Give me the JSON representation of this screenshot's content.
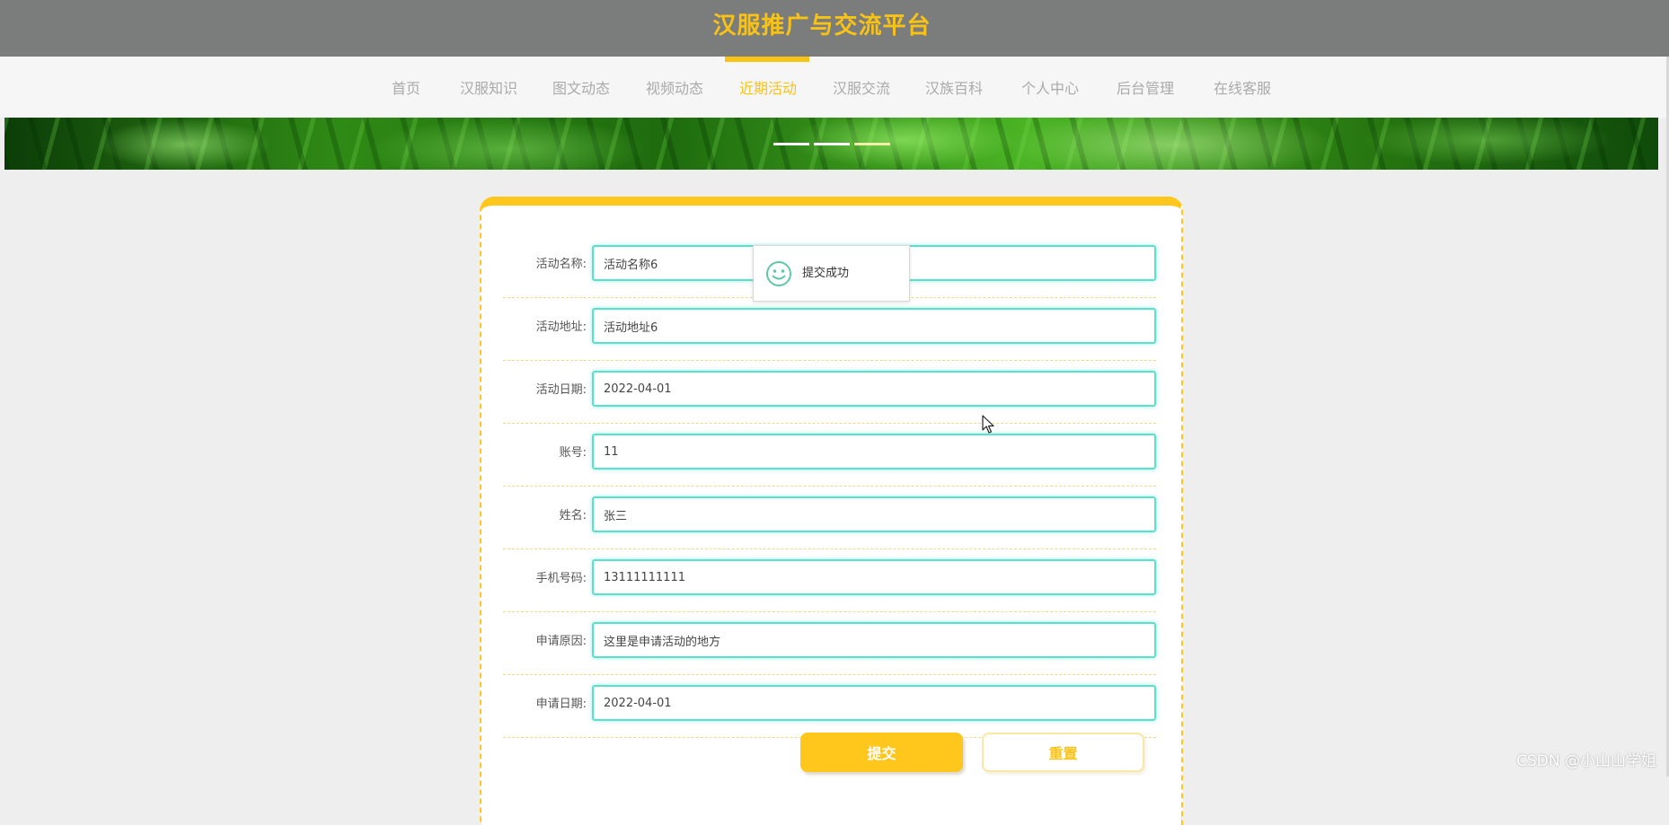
{
  "site": {
    "title": "汉服推广与交流平台"
  },
  "nav": {
    "items": [
      "首页",
      "汉服知识",
      "图文动态",
      "视频动态",
      "近期活动",
      "汉服交流",
      "汉族百科",
      "个人中心",
      "后台管理",
      "在线客服"
    ],
    "active_index": 4
  },
  "banner": {
    "slide_count": 3,
    "active_slide": 3
  },
  "form": {
    "fields": [
      {
        "label": "活动名称:",
        "value": "活动名称6"
      },
      {
        "label": "活动地址:",
        "value": "活动地址6"
      },
      {
        "label": "活动日期:",
        "value": "2022-04-01"
      },
      {
        "label": "账号:",
        "value": "11"
      },
      {
        "label": "姓名:",
        "value": "张三"
      },
      {
        "label": "手机号码:",
        "value": "13111111111"
      },
      {
        "label": "申请原因:",
        "value": "这里是申请活动的地方"
      },
      {
        "label": "申请日期:",
        "value": "2022-04-01"
      }
    ],
    "submit_label": "提交",
    "reset_label": "重置"
  },
  "toast": {
    "icon": "smile-icon",
    "message": "提交成功"
  },
  "watermark": "CSDN @小山山学姐",
  "colors": {
    "accent": "#f9c316",
    "header_bg": "#7b7c7c",
    "input_border": "#55e3ce"
  }
}
